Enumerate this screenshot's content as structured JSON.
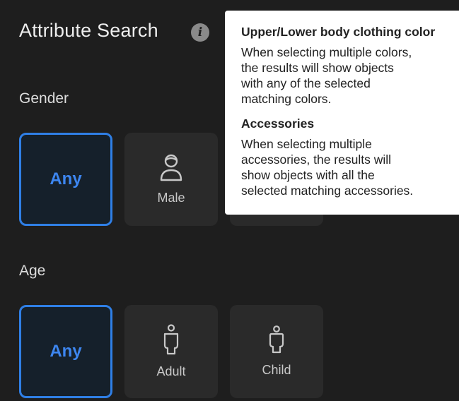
{
  "title": "Attribute Search",
  "info_icon": "info-icon",
  "gender": {
    "label": "Gender",
    "options": [
      {
        "label": "Any",
        "selected": true
      },
      {
        "label": "Male",
        "icon": "male-person-icon",
        "selected": false
      }
    ]
  },
  "age": {
    "label": "Age",
    "options": [
      {
        "label": "Any",
        "selected": true
      },
      {
        "label": "Adult",
        "icon": "adult-person-icon",
        "selected": false
      },
      {
        "label": "Child",
        "icon": "child-person-icon",
        "selected": false
      }
    ]
  },
  "tooltip": {
    "sections": [
      {
        "heading": "Upper/Lower body clothing color",
        "lines": [
          "When selecting multiple colors,",
          "the results will show objects",
          "with any of the selected",
          "matching colors."
        ]
      },
      {
        "heading": "Accessories",
        "lines": [
          "When selecting multiple",
          "accessories, the results will",
          "show objects with all the",
          "selected matching accessories."
        ]
      }
    ]
  },
  "colors": {
    "background": "#1e1e1e",
    "card": "#2a2a2a",
    "accent": "#2f7fe6",
    "tooltip_bg": "#ffffff"
  }
}
